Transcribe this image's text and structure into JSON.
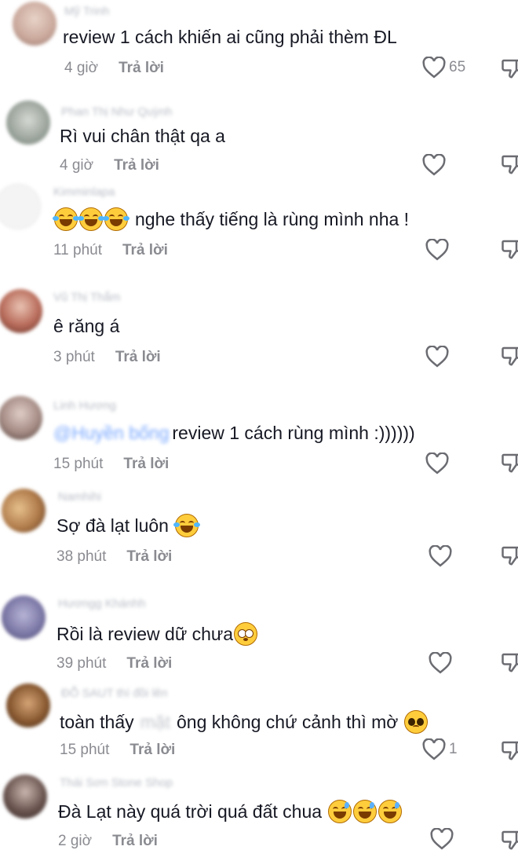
{
  "comments": [
    {
      "username": "Mỹ Trinh",
      "text": "review 1 cách khiến ai cũng phải thèm ĐL",
      "time": "4 giờ",
      "reply": "Trả lời",
      "likes": "65",
      "avatar_color": "#c9a79a"
    },
    {
      "username": "Phan Thị Như Quỳnh",
      "text": "Rì vui chân thật qa a",
      "time": "4 giờ",
      "reply": "Trả lời",
      "likes": "",
      "avatar_color": "#9aa39b"
    },
    {
      "username": "Kimminlapa",
      "text": "nghe thấy tiếng là rùng mình nha !",
      "time": "11 phút",
      "reply": "Trả lời",
      "likes": "",
      "avatar_color": "#f3f3f3"
    },
    {
      "username": "Vũ Thị Thắm",
      "text": "ê răng á",
      "time": "3 phút",
      "reply": "Trả lời",
      "likes": "",
      "avatar_color": "#b86b5a"
    },
    {
      "username": "Linh Hương",
      "mention": "@Huyền bống",
      "text": "review 1 cách rùng mình :))))))",
      "time": "15 phút",
      "reply": "Trả lời",
      "likes": "",
      "avatar_color": "#a58c85"
    },
    {
      "username": "Namhihi",
      "text": "Sợ đà lạt luôn",
      "time": "38 phút",
      "reply": "Trả lời",
      "likes": "",
      "avatar_color": "#b07b4a"
    },
    {
      "username": "Hươngg Khánhh",
      "text": "Rồi là review dữ chưa",
      "time": "39 phút",
      "reply": "Trả lời",
      "likes": "",
      "avatar_color": "#7e7aa8"
    },
    {
      "username": "ĐỖ SAUT thì đồi lên",
      "text_a": "toàn thấy",
      "blurred": "mặt",
      "text_b": "ông không chứ cảnh thì mờ",
      "time": "15 phút",
      "reply": "Trả lời",
      "likes": "1",
      "avatar_color": "#8a5a32"
    },
    {
      "username": "Thái Sơn Stone Shop",
      "text": "Đà Lạt này quá trời quá đất chua",
      "time": "2 giờ",
      "reply": "Trả lời",
      "likes": "",
      "avatar_color": "#6b5550"
    }
  ],
  "icons": {
    "like": "heart-outline-icon",
    "dislike": "thumbs-down-icon"
  },
  "colors": {
    "text": "#161823",
    "meta": "#8a8b91",
    "username": "#b8bcc4"
  }
}
